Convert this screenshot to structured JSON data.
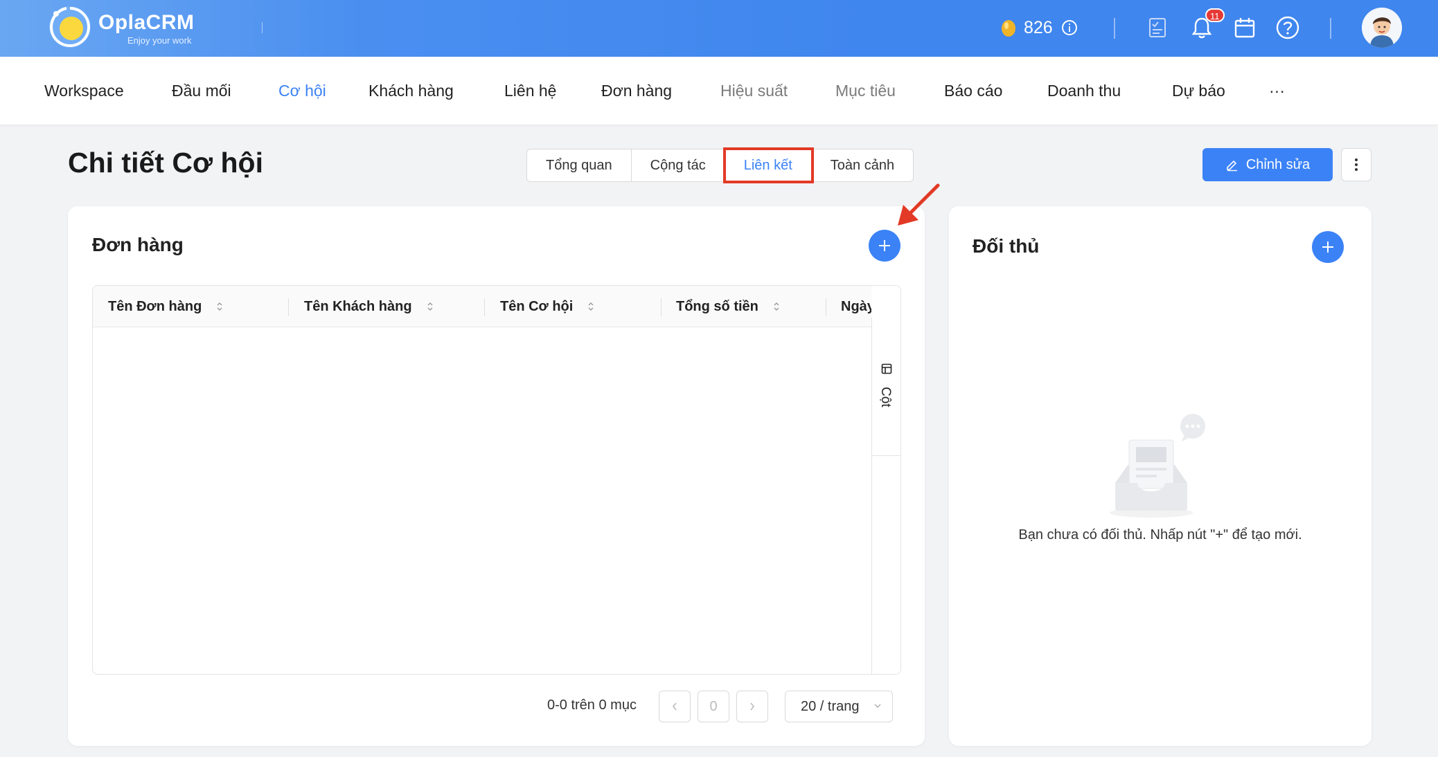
{
  "brand": {
    "name": "OplaCRM",
    "tagline": "Enjoy your work"
  },
  "header": {
    "coins": "826",
    "notification_count": "11"
  },
  "nav": {
    "items": [
      {
        "label": "Workspace",
        "state": "normal"
      },
      {
        "label": "Đầu mối",
        "state": "normal"
      },
      {
        "label": "Cơ hội",
        "state": "active"
      },
      {
        "label": "Khách hàng",
        "state": "normal"
      },
      {
        "label": "Liên hệ",
        "state": "normal"
      },
      {
        "label": "Đơn hàng",
        "state": "normal"
      },
      {
        "label": "Hiệu suất",
        "state": "muted"
      },
      {
        "label": "Mục tiêu",
        "state": "muted"
      },
      {
        "label": "Báo cáo",
        "state": "normal"
      },
      {
        "label": "Doanh thu",
        "state": "normal"
      },
      {
        "label": "Dự báo",
        "state": "normal"
      },
      {
        "label": "···",
        "state": "normal"
      }
    ]
  },
  "page": {
    "title": "Chi tiết Cơ hội",
    "tabs": [
      "Tổng quan",
      "Cộng tác",
      "Liên kết",
      "Toàn cảnh"
    ],
    "active_tab": "Liên kết",
    "edit_label": "Chỉnh sửa"
  },
  "orders": {
    "title": "Đơn hàng",
    "columns": [
      "Tên Đơn hàng",
      "Tên Khách hàng",
      "Tên Cơ hội",
      "Tổng số tiền",
      "Ngày"
    ],
    "rows": [],
    "column_toggle_label": "Cột",
    "pagination": {
      "info": "0-0 trên 0 mục",
      "current_page": "0",
      "page_size": "20 / trang"
    }
  },
  "competitors": {
    "title": "Đối thủ",
    "empty_message": "Bạn chưa có đối thủ. Nhấp nút \"+\" để tạo mới."
  },
  "colors": {
    "primary": "#3b82f6",
    "header": "#3f86ee",
    "highlight": "#e23a26"
  }
}
